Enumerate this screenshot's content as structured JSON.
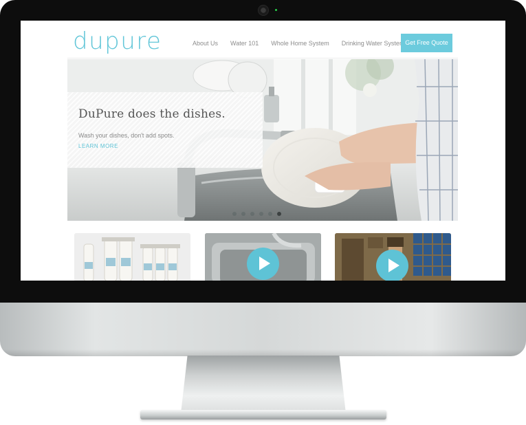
{
  "site": {
    "logo": "dupure",
    "nav": [
      "About Us",
      "Water 101",
      "Whole Home System",
      "Drinking Water System"
    ],
    "cta": "Get Free Quote"
  },
  "hero": {
    "title": "DuPure does the dishes.",
    "subtitle": "Wash your dishes, don't add spots.",
    "link": "LEARN MORE",
    "slide_count": 6,
    "active_slide": 6
  },
  "thumbnails": [
    {
      "name": "filter-systems-photo",
      "type": "image"
    },
    {
      "name": "sink-video",
      "type": "video",
      "icon": "play-icon"
    },
    {
      "name": "animated-home-video",
      "type": "video",
      "icon": "play-icon"
    }
  ],
  "colors": {
    "brand": "#62c6d8",
    "cta": "#6ccbdd",
    "nav_text": "#8c8c8c",
    "bezel": "#0d0d0d",
    "aluminum": "#d5d8d8"
  }
}
